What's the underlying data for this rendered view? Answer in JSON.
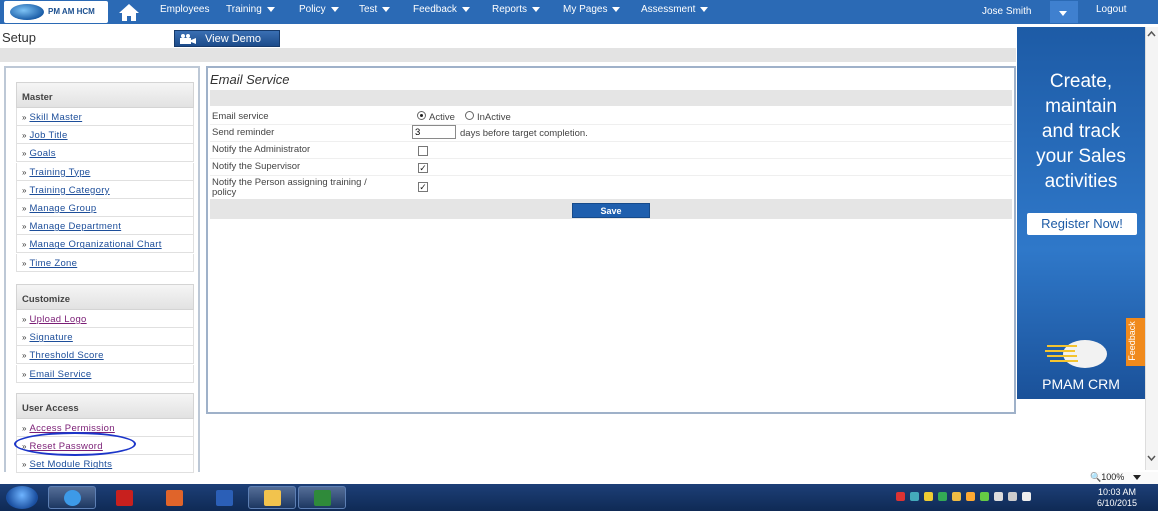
{
  "app": {
    "logo_text": "PM AM HCM",
    "nav": [
      {
        "label": "Employees",
        "dropdown": false
      },
      {
        "label": "Training",
        "dropdown": true
      },
      {
        "label": "Policy",
        "dropdown": true
      },
      {
        "label": "Test",
        "dropdown": true
      },
      {
        "label": "Feedback",
        "dropdown": true
      },
      {
        "label": "Reports",
        "dropdown": true
      },
      {
        "label": "My Pages",
        "dropdown": true
      },
      {
        "label": "Assessment",
        "dropdown": true
      }
    ],
    "user_name": "Jose Smith",
    "logout_label": "Logout"
  },
  "setup": {
    "title": "Setup",
    "view_demo_label": "View Demo"
  },
  "sidebar": {
    "sections": [
      {
        "title": "Master",
        "items": [
          "Skill Master",
          "Job Title",
          "Goals",
          "Training Type",
          "Training Category",
          "Manage Group",
          "Manage Department",
          "Manage Organizational Chart",
          "Time Zone"
        ]
      },
      {
        "title": "Customize",
        "items": [
          "Upload Logo",
          "Signature",
          "Threshold Score",
          "Email Service"
        ]
      },
      {
        "title": "User Access",
        "items": [
          "Access Permission",
          "Reset Password",
          "Set Module Rights"
        ]
      }
    ],
    "bullet": "»"
  },
  "main": {
    "title": "Email Service",
    "fields": {
      "email_service_label": "Email service",
      "active_label": "Active",
      "inactive_label": "InActive",
      "email_service_value": "Active",
      "reminder_label": "Send reminder",
      "reminder_value": "3",
      "reminder_suffix": "days before target completion.",
      "notify_admin_label": "Notify the Administrator",
      "notify_admin_checked": false,
      "notify_supervisor_label": "Notify the Supervisor",
      "notify_supervisor_checked": true,
      "notify_assigner_label": "Notify the Person assigning training / policy",
      "notify_assigner_checked": true
    },
    "save_label": "Save"
  },
  "ad": {
    "lines": [
      "Create,",
      "maintain",
      "and track",
      "your Sales",
      "activities"
    ],
    "button_label": "Register Now!",
    "brand": "PMAM CRM",
    "feedback_tab": "Feedback"
  },
  "statusbar": {
    "zoom": "100%"
  },
  "taskbar": {
    "time": "10:03 AM",
    "date": "6/10/2015"
  },
  "colors": {
    "nav_bg": "#2b6ab5",
    "link": "#1d4e9a",
    "visited_link": "#7a1d75",
    "save_button": "#1f5fae",
    "highlight_oval": "#1b35c9",
    "feedback_tab": "#f08a1c"
  }
}
